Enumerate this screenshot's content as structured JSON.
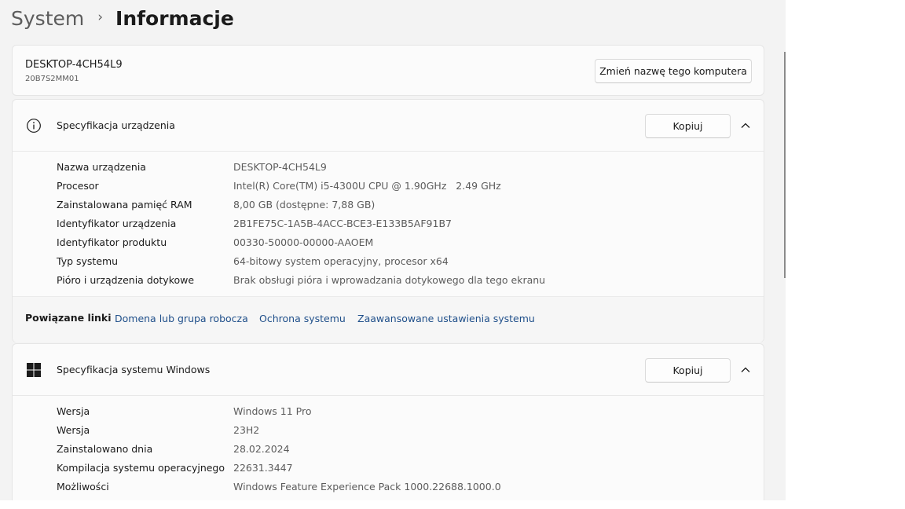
{
  "breadcrumb": {
    "root": "System",
    "separator": "›",
    "current": "Informacje"
  },
  "computer": {
    "name": "DESKTOP-4CH54L9",
    "model": "20B7S2MM01",
    "rename_button": "Zmień nazwę tego komputera"
  },
  "device_spec": {
    "icon": "info-icon",
    "title": "Specyfikacja urządzenia",
    "copy_button": "Kopiuj",
    "rows": [
      {
        "key": "Nazwa urządzenia",
        "value": "DESKTOP-4CH54L9"
      },
      {
        "key": "Procesor",
        "value": "Intel(R) Core(TM) i5-4300U CPU @ 1.90GHz   2.49 GHz"
      },
      {
        "key": "Zainstalowana pamięć RAM",
        "value": "8,00 GB (dostępne: 7,88 GB)"
      },
      {
        "key": "Identyfikator urządzenia",
        "value": "2B1FE75C-1A5B-4ACC-BCE3-E133B5AF91B7"
      },
      {
        "key": "Identyfikator produktu",
        "value": "00330-50000-00000-AAOEM"
      },
      {
        "key": "Typ systemu",
        "value": "64-bitowy system operacyjny, procesor x64"
      },
      {
        "key": "Pióro i urządzenia dotykowe",
        "value": "Brak obsługi pióra i wprowadzania dotykowego dla tego ekranu"
      }
    ]
  },
  "related_links": {
    "label": "Powiązane linki",
    "links": [
      "Domena lub grupa robocza",
      "Ochrona systemu",
      "Zaawansowane ustawienia systemu"
    ]
  },
  "windows_spec": {
    "icon": "windows-logo-icon",
    "title": "Specyfikacja systemu Windows",
    "copy_button": "Kopiuj",
    "rows": [
      {
        "key": "Wersja",
        "value": "Windows 11 Pro"
      },
      {
        "key": "Wersja",
        "value": "23H2"
      },
      {
        "key": "Zainstalowano dnia",
        "value": "28.02.2024"
      },
      {
        "key": "Kompilacja systemu operacyjnego",
        "value": "22631.3447"
      },
      {
        "key": "Możliwości",
        "value": "Windows Feature Experience Pack 1000.22688.1000.0"
      }
    ]
  }
}
